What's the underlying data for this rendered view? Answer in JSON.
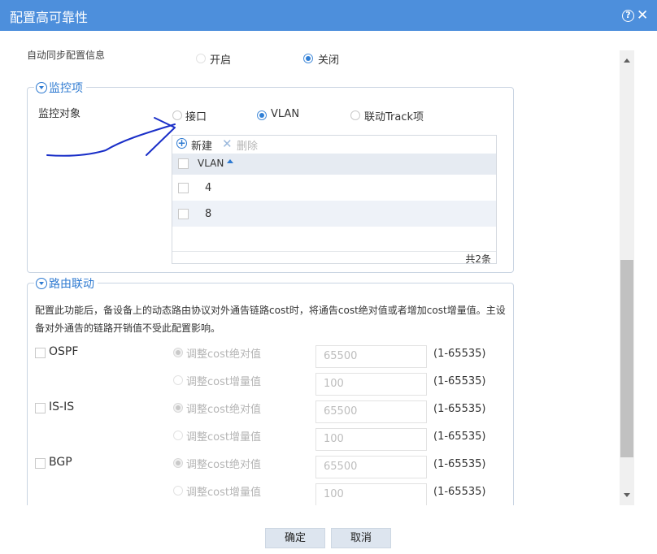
{
  "dialog": {
    "title": "配置高可靠性",
    "help_icon": "?",
    "close_icon": "✕"
  },
  "auto_sync": {
    "label": "自动同步配置信息",
    "options": [
      "开启",
      "关闭"
    ],
    "selected": "关闭"
  },
  "monitor": {
    "legend": "监控项",
    "object_label": "监控对象",
    "options": [
      "接口",
      "VLAN",
      "联动Track项"
    ],
    "selected": "VLAN",
    "toolbar": {
      "new_label": "新建",
      "delete_label": "删除"
    },
    "column_header": "VLAN",
    "rows": [
      {
        "vlan": "4"
      },
      {
        "vlan": "8"
      }
    ],
    "total": "共2条"
  },
  "route": {
    "legend": "路由联动",
    "description_line1": "配置此功能后，备设备上的动态路由协议对外通告链路cost时，将通告cost绝对值或者增加cost增量值。主设",
    "description_line2": "备对外通告的链路开销值不受此配置影响。",
    "protocols": [
      {
        "name": "OSPF",
        "abs_label": "调整cost绝对值",
        "abs_value": "65500",
        "inc_label": "调整cost增量值",
        "inc_value": "100",
        "range1": "(1-65535)",
        "range2": "(1-65535)"
      },
      {
        "name": "IS-IS",
        "abs_label": "调整cost绝对值",
        "abs_value": "65500",
        "inc_label": "调整cost增量值",
        "inc_value": "100",
        "range1": "(1-65535)",
        "range2": "(1-65535)"
      },
      {
        "name": "BGP",
        "abs_label": "调整cost绝对值",
        "abs_value": "65500",
        "inc_label": "调整cost增量值",
        "inc_value": "100",
        "range1": "(1-65535)",
        "range2": "(1-65535)"
      }
    ]
  },
  "footer": {
    "ok_label": "确定",
    "cancel_label": "取消"
  },
  "colors": {
    "accent": "#4d8fdc",
    "annotation": "#1a2fc8"
  }
}
